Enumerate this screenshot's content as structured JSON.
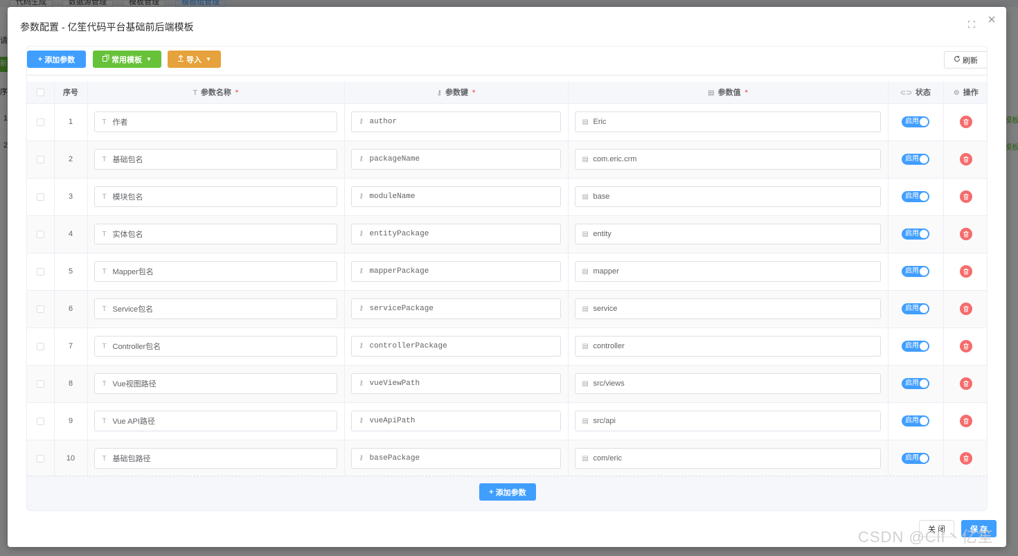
{
  "background": {
    "tabs": [
      "代码生成",
      "数据源管理",
      "模板管理",
      "模板组管理"
    ],
    "left_button": "新增",
    "left_texts": [
      "请输入",
      "序号",
      "1",
      "2"
    ],
    "right_texts": [
      "模板",
      "模板"
    ]
  },
  "dialog": {
    "title": "参数配置 - 亿笙代码平台基础前后端模板",
    "toolbar": {
      "add_label": "添加参数",
      "template_label": "常用模板",
      "import_label": "导入",
      "refresh_label": "刷新"
    },
    "table": {
      "headers": {
        "index": "序号",
        "name": "参数名称",
        "key": "参数键",
        "value": "参数值",
        "status": "状态",
        "action": "操作"
      },
      "required_mark": "*",
      "rows": [
        {
          "index": "1",
          "name": "作者",
          "key": "author",
          "value": "Eric",
          "status": "启用"
        },
        {
          "index": "2",
          "name": "基础包名",
          "key": "packageName",
          "value": "com.eric.crm",
          "status": "启用"
        },
        {
          "index": "3",
          "name": "模块包名",
          "key": "moduleName",
          "value": "base",
          "status": "启用"
        },
        {
          "index": "4",
          "name": "实体包名",
          "key": "entityPackage",
          "value": "entity",
          "status": "启用"
        },
        {
          "index": "5",
          "name": "Mapper包名",
          "key": "mapperPackage",
          "value": "mapper",
          "status": "启用"
        },
        {
          "index": "6",
          "name": "Service包名",
          "key": "servicePackage",
          "value": "service",
          "status": "启用"
        },
        {
          "index": "7",
          "name": "Controller包名",
          "key": "controllerPackage",
          "value": "controller",
          "status": "启用"
        },
        {
          "index": "8",
          "name": "Vue视图路径",
          "key": "vueViewPath",
          "value": "src/views",
          "status": "启用"
        },
        {
          "index": "9",
          "name": "Vue API路径",
          "key": "vueApiPath",
          "value": "src/api",
          "status": "启用"
        },
        {
          "index": "10",
          "name": "基础包路径",
          "key": "basePackage",
          "value": "com/eric",
          "status": "启用"
        }
      ]
    },
    "footer_add_label": "添加参数",
    "close_label": "关 闭",
    "save_label": "保 存"
  },
  "watermark": "CSDN @Clf丶亿笙",
  "colors": {
    "primary": "#409eff",
    "success": "#67c23a",
    "warning": "#e6a23c",
    "danger": "#f56c6c"
  },
  "icons": {
    "add": "plus-icon",
    "template": "copy-icon",
    "import": "upload-icon",
    "refresh": "refresh-icon",
    "name": "text-icon",
    "key": "key-icon",
    "value": "document-icon",
    "status": "toggle-icon",
    "action": "gear-icon",
    "delete": "trash-icon"
  }
}
